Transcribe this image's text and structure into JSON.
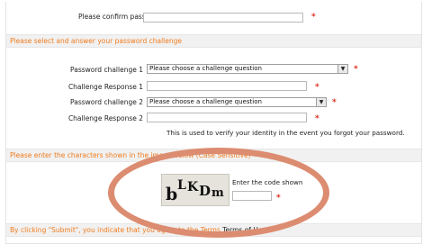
{
  "fields": {
    "confirm_password_label": "Please confirm password",
    "challenge1_label": "Password challenge 1",
    "response1_label": "Challenge Response 1",
    "challenge2_label": "Password challenge 2",
    "response2_label": "Challenge Response 2",
    "challenge_placeholder": "Please choose a challenge question",
    "required_marker": "*"
  },
  "sections": {
    "challenge_heading": "Please select and answer your password challenge",
    "challenge_note": "This is used to verify your identity in the event you forgot your password.",
    "captcha_heading": "Please enter the characters shown in the image below (Case Sensitive)",
    "captcha_prompt": "Enter the code shown",
    "captcha_code": "bLKDm",
    "submit_note": "By clicking \"Submit\", you indicate that you agree to the Terms",
    "terms_link": "Terms of Use"
  },
  "colors": {
    "accent": "#f07c1e",
    "required": "#e0301e",
    "annotation_oval": "#dc8c70"
  }
}
